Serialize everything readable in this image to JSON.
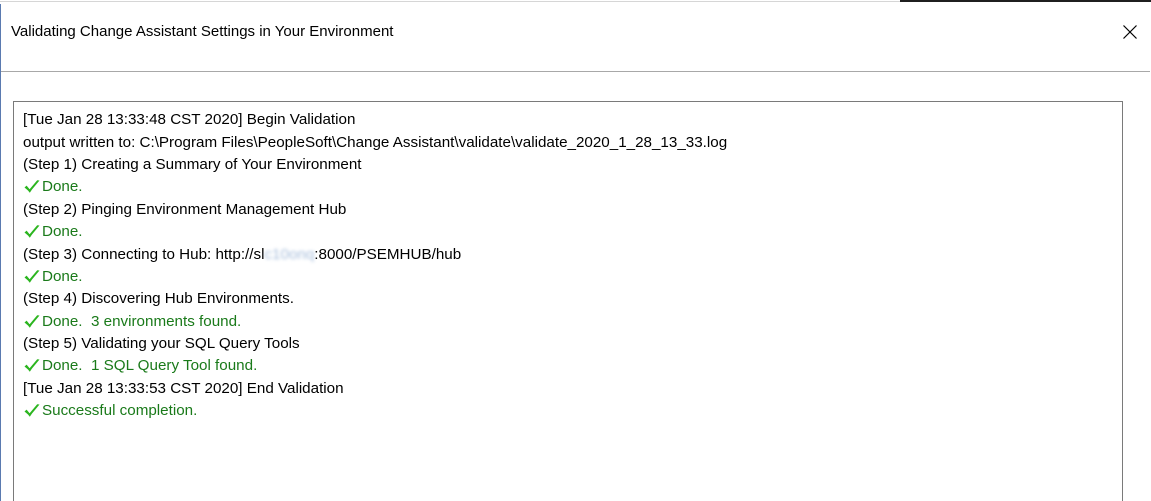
{
  "window": {
    "title": "Validating Change Assistant Settings in Your Environment",
    "close_icon": "close-icon"
  },
  "colors": {
    "success_text": "#1a7a1a",
    "check_mark": "#2bb51f",
    "panel_border": "#7a7a7a"
  },
  "log": {
    "lines": [
      {
        "type": "info",
        "text": "[Tue Jan 28 13:33:48 CST 2020] Begin Validation"
      },
      {
        "type": "info",
        "text": "output written to: C:\\Program Files\\PeopleSoft\\Change Assistant\\validate\\validate_2020_1_28_13_33.log"
      },
      {
        "type": "info",
        "text": "(Step 1) Creating a Summary of Your Environment"
      },
      {
        "type": "success",
        "icon": "checkmark-icon",
        "text": "Done."
      },
      {
        "type": "info",
        "text": "(Step 2) Pinging Environment Management Hub"
      },
      {
        "type": "success",
        "icon": "checkmark-icon",
        "text": "Done."
      },
      {
        "type": "info",
        "text_prefix": "(Step 3) Connecting to Hub: http://sl",
        "text_redacted": "c10onq",
        "text_suffix": ":8000/PSEMHUB/hub"
      },
      {
        "type": "success",
        "icon": "checkmark-icon",
        "text": "Done."
      },
      {
        "type": "info",
        "text": "(Step 4) Discovering Hub Environments."
      },
      {
        "type": "success",
        "icon": "checkmark-icon",
        "text": "Done.  3 environments found."
      },
      {
        "type": "info",
        "text": "(Step 5) Validating your SQL Query Tools"
      },
      {
        "type": "success",
        "icon": "checkmark-icon",
        "text": "Done.  1 SQL Query Tool found."
      },
      {
        "type": "info",
        "text": "[Tue Jan 28 13:33:53 CST 2020] End Validation"
      },
      {
        "type": "success",
        "icon": "checkmark-icon",
        "text": "Successful completion."
      }
    ]
  }
}
